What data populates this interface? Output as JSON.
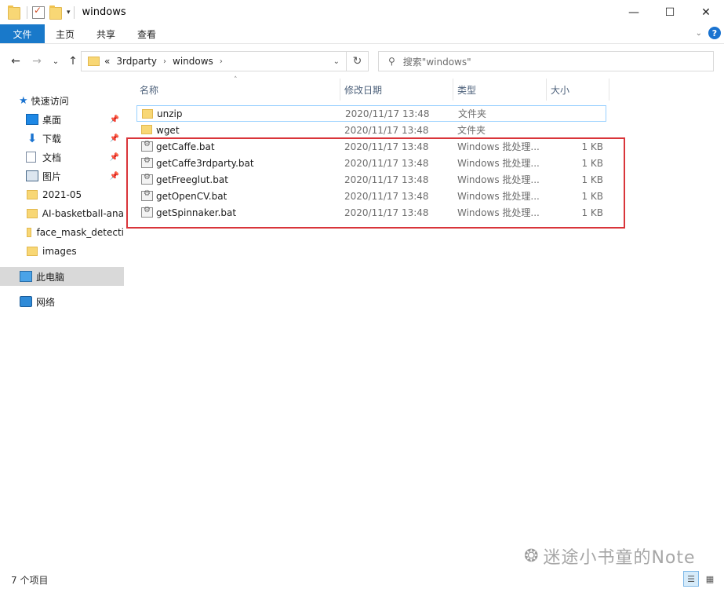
{
  "window": {
    "title": "windows",
    "controls": {
      "minimize": "—",
      "maximize": "☐",
      "close": "✕"
    }
  },
  "ribbon": {
    "tabs": [
      "文件",
      "主页",
      "共享",
      "查看"
    ]
  },
  "nav": {
    "back": "←",
    "forward": "→",
    "recent": "⌄",
    "up": "↑"
  },
  "address": {
    "overflow": "«",
    "crumbs": [
      "3rdparty",
      "windows"
    ],
    "refresh": "↻"
  },
  "search": {
    "placeholder": "搜索\"windows\""
  },
  "sidebar": {
    "quick_access": "快速访问",
    "items": [
      {
        "label": "桌面",
        "icon": "desktop-icon",
        "pinned": true
      },
      {
        "label": "下载",
        "icon": "download-icon",
        "pinned": true
      },
      {
        "label": "文档",
        "icon": "document-icon",
        "pinned": true
      },
      {
        "label": "图片",
        "icon": "picture-icon",
        "pinned": true
      },
      {
        "label": "2021-05",
        "icon": "folder-icon",
        "pinned": false
      },
      {
        "label": "AI-basketball-ana",
        "icon": "folder-icon",
        "pinned": false
      },
      {
        "label": "face_mask_detecti",
        "icon": "folder-icon",
        "pinned": false
      },
      {
        "label": "images",
        "icon": "folder-icon",
        "pinned": false
      }
    ],
    "this_pc": "此电脑",
    "network": "网络"
  },
  "columns": {
    "name": "名称",
    "date": "修改日期",
    "type": "类型",
    "size": "大小"
  },
  "files": [
    {
      "name": "unzip",
      "date": "2020/11/17 13:48",
      "type": "文件夹",
      "size": "",
      "kind": "folder"
    },
    {
      "name": "wget",
      "date": "2020/11/17 13:48",
      "type": "文件夹",
      "size": "",
      "kind": "folder"
    },
    {
      "name": "getCaffe.bat",
      "date": "2020/11/17 13:48",
      "type": "Windows 批处理...",
      "size": "1 KB",
      "kind": "bat"
    },
    {
      "name": "getCaffe3rdparty.bat",
      "date": "2020/11/17 13:48",
      "type": "Windows 批处理...",
      "size": "1 KB",
      "kind": "bat"
    },
    {
      "name": "getFreeglut.bat",
      "date": "2020/11/17 13:48",
      "type": "Windows 批处理...",
      "size": "1 KB",
      "kind": "bat"
    },
    {
      "name": "getOpenCV.bat",
      "date": "2020/11/17 13:48",
      "type": "Windows 批处理...",
      "size": "1 KB",
      "kind": "bat"
    },
    {
      "name": "getSpinnaker.bat",
      "date": "2020/11/17 13:48",
      "type": "Windows 批处理...",
      "size": "1 KB",
      "kind": "bat"
    }
  ],
  "status": {
    "item_count": "7 个项目"
  },
  "watermark": {
    "text": "迷途小书童的Note"
  },
  "colors": {
    "file_tab": "#1979ca",
    "highlight": "#d9353a",
    "folder": "#f8d775"
  }
}
